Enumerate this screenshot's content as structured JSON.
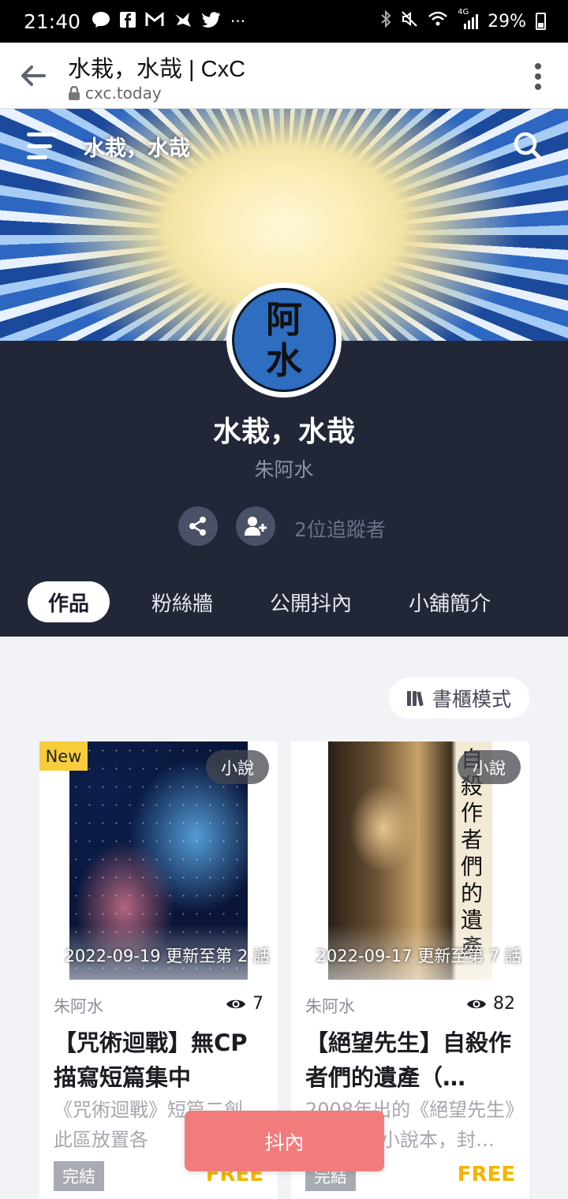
{
  "status_bar": {
    "time": "21:40",
    "left_icons": [
      "line-icon",
      "facebook-icon",
      "gmail-icon",
      "bird-icon",
      "twitter-icon",
      "more-icon"
    ],
    "more": "···",
    "signal_label": "4G",
    "battery": "29%"
  },
  "browser": {
    "title": "水栽，水哉 | CxC",
    "url": "cxc.today"
  },
  "header": {
    "shop_title": "水栽，水哉"
  },
  "profile": {
    "avatar_text_1": "阿",
    "avatar_text_2": "水",
    "shop_name": "水栽，水哉",
    "author": "朱阿水",
    "followers": "2位追蹤者"
  },
  "tabs": [
    "作品",
    "粉絲牆",
    "公開抖內",
    "小舖簡介"
  ],
  "shelf_mode_label": "書櫃模式",
  "cards": [
    {
      "new_badge": "New",
      "type": "小說",
      "update": "2022-09-19 更新至第 2 話",
      "author": "朱阿水",
      "views": "7",
      "title": "【咒術迴戰】無CP描寫短篇集中",
      "desc": "《咒術迴戰》短篇二創，此區放置各",
      "status": "完結",
      "price": "FREE"
    },
    {
      "type": "小說",
      "spine_text": "自殺作者們的遺產",
      "update": "2022-09-17 更新至第 7 話",
      "author": "朱阿水",
      "views": "82",
      "title": "【絕望先生】自殺作者們的遺產（…",
      "desc": "2008年出的《絕望先生》同人整理小說本，封…",
      "status": "完結",
      "price": "FREE"
    }
  ],
  "donate_button": "抖內",
  "colors": {
    "profile_bg": "#222738",
    "new_badge": "#f7cd3c",
    "price": "#f5b400",
    "donate": "#f27c7c"
  }
}
